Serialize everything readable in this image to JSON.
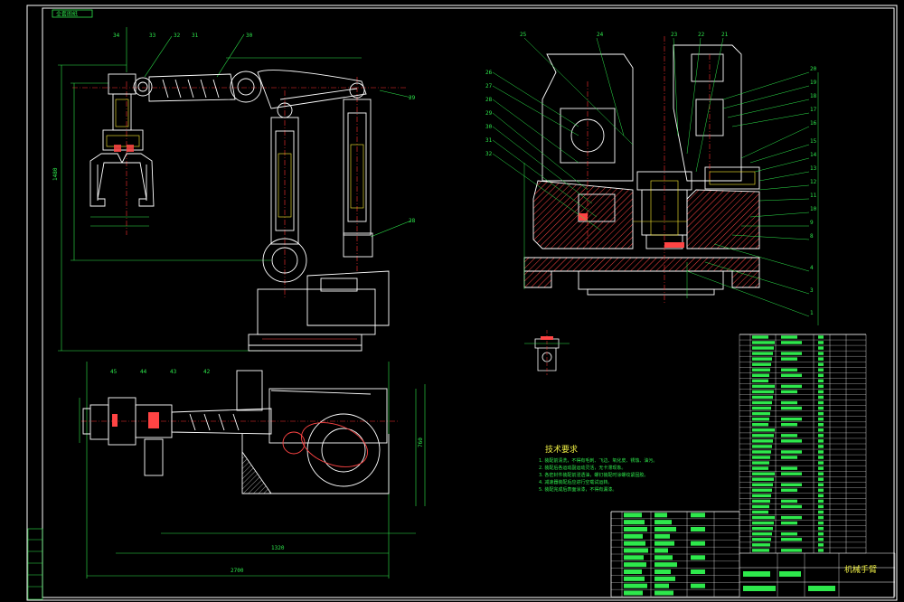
{
  "drawing": {
    "stamp_text": "全套图纸",
    "title_block_label": "机械手臂",
    "tech_requirements_title": "技术要求",
    "tech_requirements_lines": [
      "1. 装配前清洗，不得有毛刺、飞边、氧化皮、锈蚀、油污。",
      "2. 装配后各运动副运动灵活，无卡滞现象。",
      "3. 各密封件装配前浸透油，螺钉装配时涂螺纹紧固胶。",
      "4. 减速器装配后应进行空载试运转。",
      "5. 装配完成后表面涂漆，不得有漏漆。"
    ],
    "dims": {
      "overall_width": "2700",
      "base_length": "1320",
      "side_depth": "760",
      "height_left": "1480"
    },
    "colors": {
      "background": "#000000",
      "outline": "#ffffff",
      "dimension": "#2ee84c",
      "centerline": "#ff3030",
      "hidden": "#ffee33",
      "section_fill": "#ff4444",
      "text_accent": "#eeee44"
    }
  }
}
